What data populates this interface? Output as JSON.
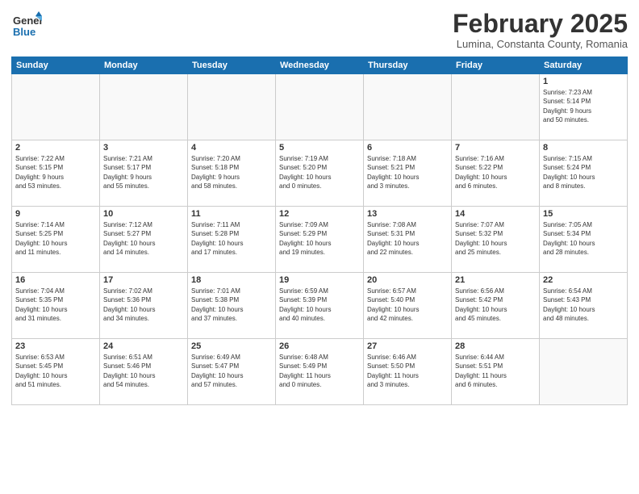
{
  "header": {
    "logo_general": "General",
    "logo_blue": "Blue",
    "month_title": "February 2025",
    "location": "Lumina, Constanta County, Romania"
  },
  "days_of_week": [
    "Sunday",
    "Monday",
    "Tuesday",
    "Wednesday",
    "Thursday",
    "Friday",
    "Saturday"
  ],
  "weeks": [
    [
      {
        "num": "",
        "info": ""
      },
      {
        "num": "",
        "info": ""
      },
      {
        "num": "",
        "info": ""
      },
      {
        "num": "",
        "info": ""
      },
      {
        "num": "",
        "info": ""
      },
      {
        "num": "",
        "info": ""
      },
      {
        "num": "1",
        "info": "Sunrise: 7:23 AM\nSunset: 5:14 PM\nDaylight: 9 hours\nand 50 minutes."
      }
    ],
    [
      {
        "num": "2",
        "info": "Sunrise: 7:22 AM\nSunset: 5:15 PM\nDaylight: 9 hours\nand 53 minutes."
      },
      {
        "num": "3",
        "info": "Sunrise: 7:21 AM\nSunset: 5:17 PM\nDaylight: 9 hours\nand 55 minutes."
      },
      {
        "num": "4",
        "info": "Sunrise: 7:20 AM\nSunset: 5:18 PM\nDaylight: 9 hours\nand 58 minutes."
      },
      {
        "num": "5",
        "info": "Sunrise: 7:19 AM\nSunset: 5:20 PM\nDaylight: 10 hours\nand 0 minutes."
      },
      {
        "num": "6",
        "info": "Sunrise: 7:18 AM\nSunset: 5:21 PM\nDaylight: 10 hours\nand 3 minutes."
      },
      {
        "num": "7",
        "info": "Sunrise: 7:16 AM\nSunset: 5:22 PM\nDaylight: 10 hours\nand 6 minutes."
      },
      {
        "num": "8",
        "info": "Sunrise: 7:15 AM\nSunset: 5:24 PM\nDaylight: 10 hours\nand 8 minutes."
      }
    ],
    [
      {
        "num": "9",
        "info": "Sunrise: 7:14 AM\nSunset: 5:25 PM\nDaylight: 10 hours\nand 11 minutes."
      },
      {
        "num": "10",
        "info": "Sunrise: 7:12 AM\nSunset: 5:27 PM\nDaylight: 10 hours\nand 14 minutes."
      },
      {
        "num": "11",
        "info": "Sunrise: 7:11 AM\nSunset: 5:28 PM\nDaylight: 10 hours\nand 17 minutes."
      },
      {
        "num": "12",
        "info": "Sunrise: 7:09 AM\nSunset: 5:29 PM\nDaylight: 10 hours\nand 19 minutes."
      },
      {
        "num": "13",
        "info": "Sunrise: 7:08 AM\nSunset: 5:31 PM\nDaylight: 10 hours\nand 22 minutes."
      },
      {
        "num": "14",
        "info": "Sunrise: 7:07 AM\nSunset: 5:32 PM\nDaylight: 10 hours\nand 25 minutes."
      },
      {
        "num": "15",
        "info": "Sunrise: 7:05 AM\nSunset: 5:34 PM\nDaylight: 10 hours\nand 28 minutes."
      }
    ],
    [
      {
        "num": "16",
        "info": "Sunrise: 7:04 AM\nSunset: 5:35 PM\nDaylight: 10 hours\nand 31 minutes."
      },
      {
        "num": "17",
        "info": "Sunrise: 7:02 AM\nSunset: 5:36 PM\nDaylight: 10 hours\nand 34 minutes."
      },
      {
        "num": "18",
        "info": "Sunrise: 7:01 AM\nSunset: 5:38 PM\nDaylight: 10 hours\nand 37 minutes."
      },
      {
        "num": "19",
        "info": "Sunrise: 6:59 AM\nSunset: 5:39 PM\nDaylight: 10 hours\nand 40 minutes."
      },
      {
        "num": "20",
        "info": "Sunrise: 6:57 AM\nSunset: 5:40 PM\nDaylight: 10 hours\nand 42 minutes."
      },
      {
        "num": "21",
        "info": "Sunrise: 6:56 AM\nSunset: 5:42 PM\nDaylight: 10 hours\nand 45 minutes."
      },
      {
        "num": "22",
        "info": "Sunrise: 6:54 AM\nSunset: 5:43 PM\nDaylight: 10 hours\nand 48 minutes."
      }
    ],
    [
      {
        "num": "23",
        "info": "Sunrise: 6:53 AM\nSunset: 5:45 PM\nDaylight: 10 hours\nand 51 minutes."
      },
      {
        "num": "24",
        "info": "Sunrise: 6:51 AM\nSunset: 5:46 PM\nDaylight: 10 hours\nand 54 minutes."
      },
      {
        "num": "25",
        "info": "Sunrise: 6:49 AM\nSunset: 5:47 PM\nDaylight: 10 hours\nand 57 minutes."
      },
      {
        "num": "26",
        "info": "Sunrise: 6:48 AM\nSunset: 5:49 PM\nDaylight: 11 hours\nand 0 minutes."
      },
      {
        "num": "27",
        "info": "Sunrise: 6:46 AM\nSunset: 5:50 PM\nDaylight: 11 hours\nand 3 minutes."
      },
      {
        "num": "28",
        "info": "Sunrise: 6:44 AM\nSunset: 5:51 PM\nDaylight: 11 hours\nand 6 minutes."
      },
      {
        "num": "",
        "info": ""
      }
    ]
  ]
}
